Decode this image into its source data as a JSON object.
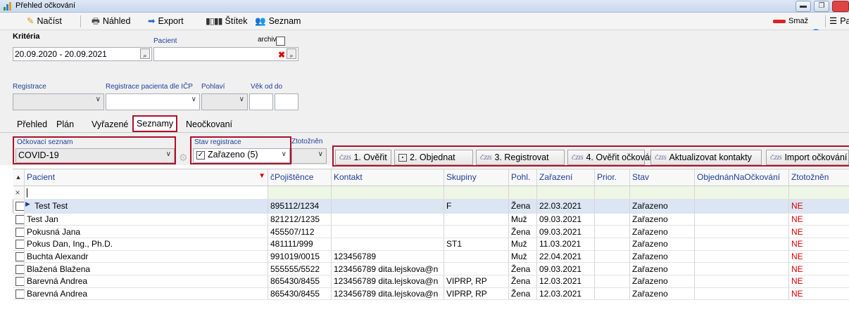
{
  "window": {
    "title": "Přehled očkování"
  },
  "toolbar": {
    "nacist": "Načíst",
    "nahled": "Náhled",
    "export": "Export",
    "stitek": "Štítek",
    "seznam": "Seznam",
    "smaz": "Smaž",
    "pa": "Pa"
  },
  "criteria": {
    "title": "Kritéria",
    "pacient_label": "Pacient",
    "archiv_label": "archiv",
    "date_range": "20.09.2020 - 20.09.2021",
    "pacient_value": "",
    "registrace_label": "Registrace",
    "registrace_icp_label": "Registrace pacienta dle IČP",
    "pohlavi_label": "Pohlaví",
    "vek_label": "Věk od do"
  },
  "tabs": [
    "Přehled",
    "Plán",
    "Vyřazené",
    "Seznamy",
    "Neočkovaní"
  ],
  "active_tab": "Seznamy",
  "filters": {
    "ockovaci_label": "Očkovací seznam",
    "ockovaci_value": "COVID-19",
    "stav_label": "Stav registrace",
    "stav_value": "Zařazeno (5)",
    "ztotozneni_label": "Ztotožněn"
  },
  "actions": [
    "1. Ověřit",
    "2. Objednat",
    "3. Registrovat",
    "4. Ověřit očkování",
    "Aktualizovat kontakty",
    "Import očkování"
  ],
  "czb_tag": "ČZIS",
  "table": {
    "headers": [
      "Pacient",
      "čPojištěnce",
      "Kontakt",
      "Skupiny",
      "Pohl.",
      "Zařazení",
      "Prior.",
      "Stav",
      "ObjednánNaOčkování",
      "Ztotožněn"
    ],
    "rows": [
      [
        "Test Test",
        "895112/1234",
        "",
        "F",
        "Žena",
        "22.03.2021",
        "",
        "Zařazeno",
        "",
        "NE"
      ],
      [
        "Test Jan",
        "821212/1235",
        "",
        "",
        "Muž",
        "09.03.2021",
        "",
        "Zařazeno",
        "",
        "NE"
      ],
      [
        "Pokusná Jana",
        "455507/112",
        "",
        "",
        "Žena",
        "09.03.2021",
        "",
        "Zařazeno",
        "",
        "NE"
      ],
      [
        "Pokus Dan, Ing., Ph.D.",
        "481111/999",
        "",
        "ST1",
        "Muž",
        "11.03.2021",
        "",
        "Zařazeno",
        "",
        "NE"
      ],
      [
        "Buchta Alexandr",
        "991019/0015",
        "123456789",
        "",
        "Muž",
        "22.04.2021",
        "",
        "Zařazeno",
        "",
        "NE"
      ],
      [
        "Blažená  Blažena",
        "555555/5522",
        "123456789 dita.lejskova@n",
        "",
        "Žena",
        "09.03.2021",
        "",
        "Zařazeno",
        "",
        "NE"
      ],
      [
        "Barevná Andrea",
        "865430/8455",
        "123456789 dita.lejskova@n",
        "VIPRP, RP",
        "Žena",
        "12.03.2021",
        "",
        "Zařazeno",
        "",
        "NE"
      ],
      [
        "Barevná Andrea",
        "865430/8455",
        "123456789 dita.lejskova@n",
        "VIPRP, RP",
        "Žena",
        "12.03.2021",
        "",
        "Zařazeno",
        "",
        "NE"
      ]
    ]
  },
  "colors": {
    "accent": "#1f3f99",
    "highlight": "#b0102a",
    "no": "#e00000"
  }
}
